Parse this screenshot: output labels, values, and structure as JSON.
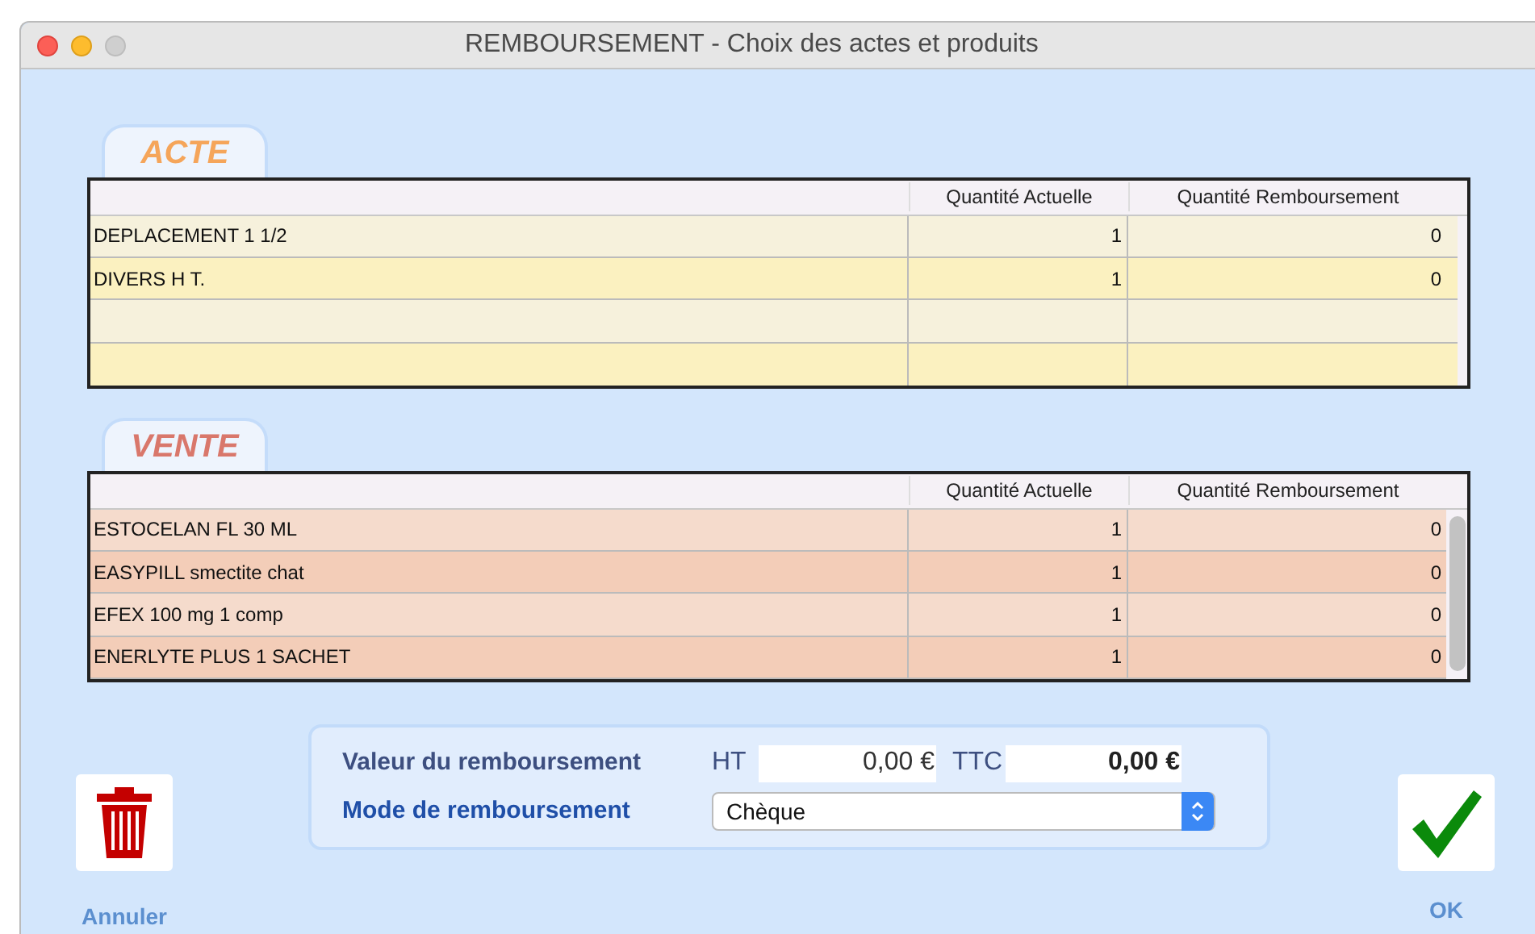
{
  "window": {
    "title": "REMBOURSEMENT - Choix des actes et produits"
  },
  "sections": [
    {
      "kind": "acte",
      "tab": "ACTE",
      "columns": [
        "Quantité Actuelle",
        "Quantité Remboursement"
      ],
      "scrollbar": false,
      "rows": [
        {
          "name": "DEPLACEMENT 1 1/2",
          "quantite_actuelle": "1",
          "quantite_remboursement": "0"
        },
        {
          "name": "DIVERS H T.",
          "quantite_actuelle": "1",
          "quantite_remboursement": "0"
        }
      ]
    },
    {
      "kind": "vente",
      "tab": "VENTE",
      "columns": [
        "Quantité Actuelle",
        "Quantité Remboursement"
      ],
      "scrollbar": true,
      "rows": [
        {
          "name": "ESTOCELAN  FL  30 ML",
          "quantite_actuelle": "1",
          "quantite_remboursement": "0"
        },
        {
          "name": "EASYPILL smectite chat",
          "quantite_actuelle": "1",
          "quantite_remboursement": "0"
        },
        {
          "name": "EFEX 100 mg  1 comp",
          "quantite_actuelle": "1",
          "quantite_remboursement": "0"
        },
        {
          "name": "ENERLYTE PLUS  1 SACHET",
          "quantite_actuelle": "1",
          "quantite_remboursement": "0"
        }
      ]
    }
  ],
  "summary": {
    "value_label": "Valeur du remboursement",
    "ht_label": "HT",
    "ht_value": "0,00 €",
    "ttc_label": "TTC",
    "ttc_value": "0,00 €",
    "mode_label": "Mode de remboursement",
    "mode_value": "Chèque"
  },
  "buttons": [
    {
      "kind": "cancel",
      "label": "Annuler"
    },
    {
      "kind": "ok",
      "label": "OK"
    }
  ]
}
